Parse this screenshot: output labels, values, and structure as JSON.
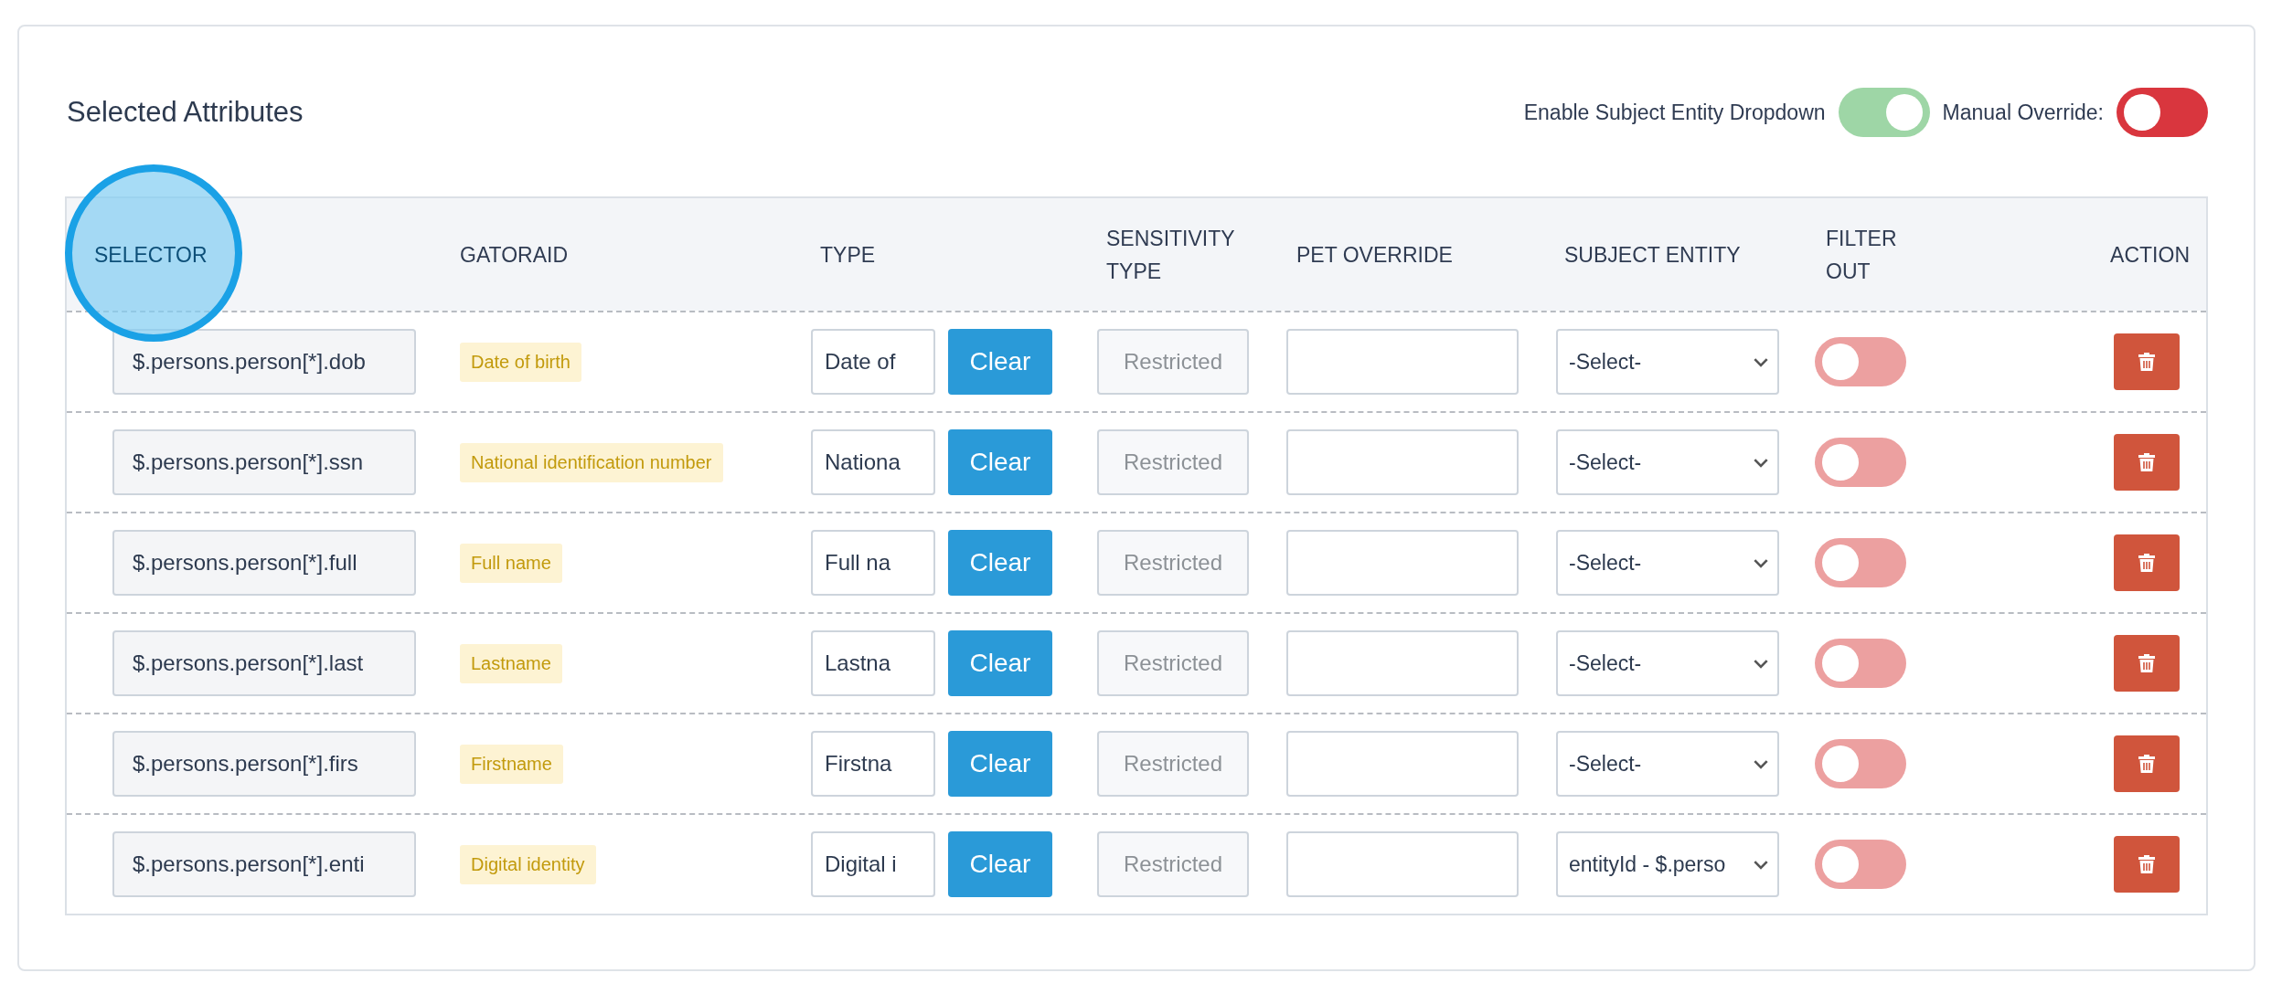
{
  "panel": {
    "title": "Selected Attributes",
    "toggles": [
      {
        "label": "Enable Subject Entity Dropdown",
        "on": true,
        "kind": "success"
      },
      {
        "label": "Manual Override:",
        "on": false,
        "kind": "danger"
      }
    ]
  },
  "table": {
    "columns": [
      {
        "label": "SELECTOR",
        "highlighted": true
      },
      {
        "label": "GATORAID",
        "highlighted": false
      },
      {
        "label": "TYPE",
        "highlighted": false
      },
      {
        "label": "SENSITIVITY TYPE",
        "highlighted": false
      },
      {
        "label": "PET OVERRIDE",
        "highlighted": false
      },
      {
        "label": "SUBJECT ENTITY",
        "highlighted": false
      },
      {
        "label": "FILTER OUT",
        "highlighted": false
      },
      {
        "label": "ACTION",
        "highlighted": false
      }
    ],
    "rows": [
      {
        "selector": "$.persons.person[*].dob",
        "gatoraid": "Date of birth",
        "type": "Date of",
        "clear": "Clear",
        "sensitivity": "Restricted",
        "sensitivity_disabled": true,
        "subject_entity": "-Select-",
        "filter_out": false
      },
      {
        "selector": "$.persons.person[*].ssn",
        "gatoraid": "National identification number",
        "type": "Nationa",
        "clear": "Clear",
        "sensitivity": "Restricted",
        "sensitivity_disabled": true,
        "subject_entity": "-Select-",
        "filter_out": false
      },
      {
        "selector": "$.persons.person[*].full",
        "gatoraid": "Full name",
        "type": "Full na",
        "clear": "Clear",
        "sensitivity": "Restricted",
        "sensitivity_disabled": true,
        "subject_entity": "-Select-",
        "filter_out": false
      },
      {
        "selector": "$.persons.person[*].last",
        "gatoraid": "Lastname",
        "type": "Lastna",
        "clear": "Clear",
        "sensitivity": "Restricted",
        "sensitivity_disabled": true,
        "subject_entity": "-Select-",
        "filter_out": false
      },
      {
        "selector": "$.persons.person[*].firs",
        "gatoraid": "Firstname",
        "type": "Firstna",
        "clear": "Clear",
        "sensitivity": "Restricted",
        "sensitivity_disabled": true,
        "subject_entity": "-Select-",
        "filter_out": false
      },
      {
        "selector": "$.persons.person[*].enti",
        "gatoraid": "Digital identity",
        "type": "Digital i",
        "clear": "Clear",
        "sensitivity": "Restricted",
        "sensitivity_disabled": true,
        "subject_entity": "entityId - $.perso",
        "filter_out": false
      }
    ]
  }
}
